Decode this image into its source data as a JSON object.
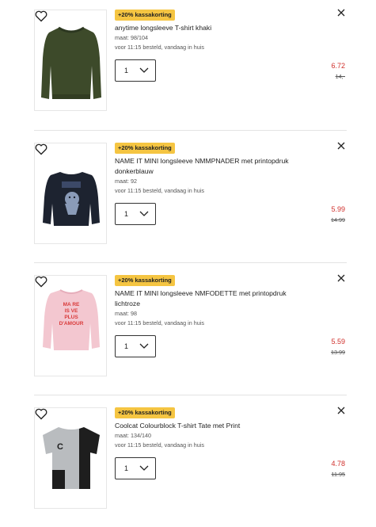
{
  "items": [
    {
      "badge": "+20% kassakorting",
      "title": "anytime longsleeve T-shirt khaki",
      "size": "maat: 98/104",
      "delivery": "voor 11:15 besteld, vandaag in huis",
      "quantity": "1",
      "price_new": "6.72",
      "price_old": "14,-",
      "image": "khaki-sweater"
    },
    {
      "badge": "+20% kassakorting",
      "title": "NAME IT MINI longsleeve NMMPNADER met printopdruk donkerblauw",
      "size": "maat: 92",
      "delivery": "voor 11:15 besteld, vandaag in huis",
      "quantity": "1",
      "price_new": "5.99",
      "price_old": "14.99",
      "image": "navy-longsleeve-print"
    },
    {
      "badge": "+20% kassakorting",
      "title": "NAME IT MINI longsleeve NMFODETTE met printopdruk lichtroze",
      "size": "maat: 98",
      "delivery": "voor 11:15 besteld, vandaag in huis",
      "quantity": "1",
      "price_new": "5.59",
      "price_old": "13.99",
      "image": "pink-longsleeve-print",
      "print_text": [
        "MA RE",
        "IS VE",
        "PLUS",
        "D'AMOUR"
      ]
    },
    {
      "badge": "+20% kassakorting",
      "title": "Coolcat Colourblock T-shirt Tate met Print",
      "size": "maat: 134/140",
      "delivery": "voor 11:15 besteld, vandaag in huis",
      "quantity": "1",
      "price_new": "4.78",
      "price_old": "11.95",
      "image": "grey-black-tshirt",
      "print_text": [
        "C"
      ]
    }
  ],
  "colors": {
    "badge": "#f5c542",
    "price_new": "#d0312d"
  }
}
